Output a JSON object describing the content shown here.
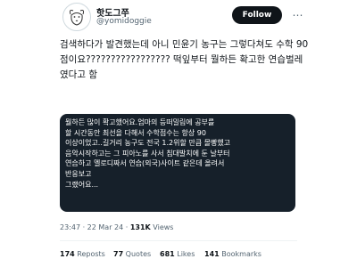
{
  "author": {
    "display_name": "핫도그쭈",
    "handle": "@yomidoggie",
    "avatar_icon": "dog-sketch-avatar"
  },
  "follow_label": "Follow",
  "more_icon": "ellipsis-icon",
  "tweet_text_lines": [
    "검색하다가 발견했는데 아니 민윤기 농구는 그렇다쳐도 수학 90",
    "점이요????????????????? 떡잎부터 뭘하든 확고한 연습벌레",
    "였다고 함"
  ],
  "media_text_lines": [
    "뭘하든 많이 확고했어요.엄마의 등떠밀림에 공부를",
    "할 시간동안 최선을 다해서 수학점수는 항상 90",
    "이상이었고..길거리 농구도 전국 1.2위할 만큼 몰빵했고",
    "음악시작하고는 그 피아노를 사서 침대발치에 둔 날부터",
    "연습하고 멜로디짜서 연습(외국)사이트 같은데 올려서",
    "반응보고",
    "그랬어요..."
  ],
  "timestamp": "23:47 · 22 Mar 24 · ",
  "views_value": "131K",
  "views_label": " Views",
  "stats": {
    "reposts_count": "174",
    "reposts_label": " Reposts",
    "quotes_count": "77",
    "quotes_label": " Quotes",
    "likes_count": "681",
    "likes_label": " Likes",
    "bookmarks_count": "141",
    "bookmarks_label": " Bookmarks"
  },
  "colors": {
    "text_primary": "#0f1419",
    "text_secondary": "#536471",
    "media_background": "#16202a",
    "follow_button": "#0f1419"
  }
}
